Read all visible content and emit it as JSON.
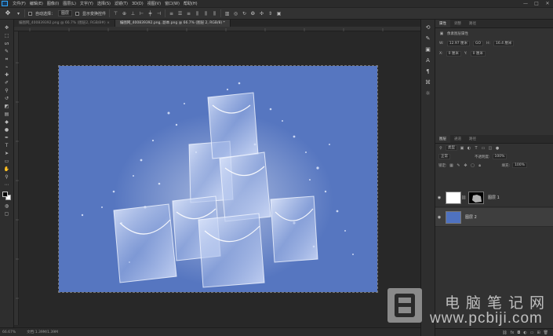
{
  "menubar": {
    "items": [
      "文件(F)",
      "编辑(E)",
      "图像(I)",
      "图层(L)",
      "文字(Y)",
      "选择(S)",
      "滤镜(T)",
      "3D(D)",
      "视图(V)",
      "窗口(W)",
      "帮助(H)"
    ],
    "window_controls": [
      "—",
      "□",
      "✕"
    ]
  },
  "options": {
    "auto_select_label": "自动选择：",
    "auto_select_value": "图层",
    "show_transform_label": "显示变换控件"
  },
  "tabs": [
    {
      "label": "编图网_400839392.png @ 66.7% (图层2, RGB/8#) ×"
    },
    {
      "label": "编图网_400839392.png, 副本.png @ 66.7% (图层 2, RGB/8) *"
    }
  ],
  "status": {
    "zoom": "66.67%",
    "doc": "文档:1.39M/1.39M"
  },
  "properties": {
    "tabs": [
      "属性",
      "调整",
      "路径"
    ],
    "title": "像素图层属性",
    "w_label": "W:",
    "w_value": "12.97 厘米",
    "link": "GO",
    "h_label": "H:",
    "h_value": "16.4 厘米",
    "x_label": "X:",
    "x_value": "0 厘米",
    "y_label": "Y:",
    "y_value": "0 厘米"
  },
  "layers_panel": {
    "tabs": [
      "图层",
      "通道",
      "路径"
    ],
    "kind": "类型",
    "blend": "正常",
    "opacity_label": "不透明度:",
    "opacity": "100%",
    "lock_label": "锁定:",
    "fill_label": "填充:",
    "fill": "100%",
    "layers": [
      {
        "name": "图层 1",
        "thumb_color": "#ffffff"
      },
      {
        "name": "图层 2",
        "thumb_color": "#4f72c0"
      }
    ]
  },
  "canvas": {
    "bg_color": "#5676c0"
  },
  "watermark": {
    "cn": "电脑笔记网",
    "url": "www.pcbiji.com"
  }
}
